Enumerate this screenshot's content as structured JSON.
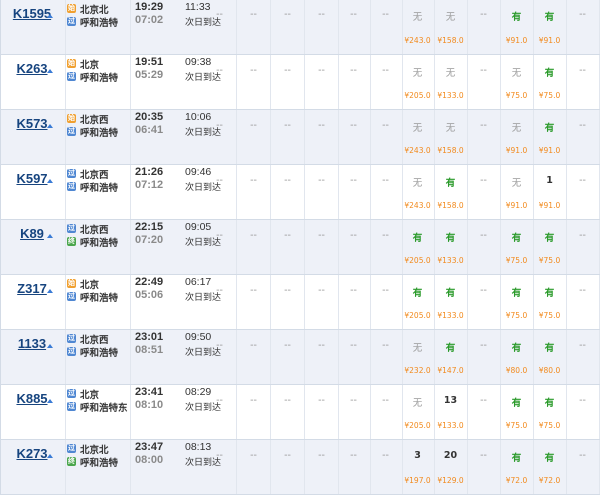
{
  "trains": [
    {
      "no": "K1595",
      "from_icon": "始",
      "to_icon": "过",
      "from": "北京北",
      "to": "呼和浩特",
      "dep": "19:29",
      "duration": "07:02",
      "arr": "11:33",
      "arr_day": "次日到达",
      "seats": {
        "c1": "--",
        "c2": "--",
        "c3": "--",
        "c4": "--",
        "c5": "--",
        "c6": "--",
        "c7": "无",
        "c8": "无",
        "c9": "--",
        "c10": "有",
        "c11": "有",
        "c12": "--"
      },
      "prices": {
        "c7": "¥243.0",
        "c8": "¥158.0",
        "c10": "¥91.0",
        "c11": "¥91.0"
      }
    },
    {
      "no": "K263",
      "from_icon": "始",
      "to_icon": "过",
      "from": "北京",
      "to": "呼和浩特",
      "dep": "19:51",
      "duration": "05:29",
      "arr": "09:38",
      "arr_day": "次日到达",
      "seats": {
        "c1": "--",
        "c2": "--",
        "c3": "--",
        "c4": "--",
        "c5": "--",
        "c6": "--",
        "c7": "无",
        "c8": "无",
        "c9": "--",
        "c10": "无",
        "c11": "有",
        "c12": "--"
      },
      "prices": {
        "c7": "¥205.0",
        "c8": "¥133.0",
        "c10": "¥75.0",
        "c11": "¥75.0"
      }
    },
    {
      "no": "K573",
      "from_icon": "始",
      "to_icon": "过",
      "from": "北京西",
      "to": "呼和浩特",
      "dep": "20:35",
      "duration": "06:41",
      "arr": "10:06",
      "arr_day": "次日到达",
      "seats": {
        "c1": "--",
        "c2": "--",
        "c3": "--",
        "c4": "--",
        "c5": "--",
        "c6": "--",
        "c7": "无",
        "c8": "无",
        "c9": "--",
        "c10": "无",
        "c11": "有",
        "c12": "--"
      },
      "prices": {
        "c7": "¥243.0",
        "c8": "¥158.0",
        "c10": "¥91.0",
        "c11": "¥91.0"
      }
    },
    {
      "no": "K597",
      "from_icon": "过",
      "to_icon": "过",
      "from": "北京西",
      "to": "呼和浩特",
      "dep": "21:26",
      "duration": "07:12",
      "arr": "09:46",
      "arr_day": "次日到达",
      "seats": {
        "c1": "--",
        "c2": "--",
        "c3": "--",
        "c4": "--",
        "c5": "--",
        "c6": "--",
        "c7": "无",
        "c8": "有",
        "c9": "--",
        "c10": "无",
        "c11": "1",
        "c12": "--"
      },
      "prices": {
        "c7": "¥243.0",
        "c8": "¥158.0",
        "c10": "¥91.0",
        "c11": "¥91.0"
      }
    },
    {
      "no": "K89",
      "from_icon": "过",
      "to_icon": "终",
      "from": "北京西",
      "to": "呼和浩特",
      "dep": "22:15",
      "duration": "07:20",
      "arr": "09:05",
      "arr_day": "次日到达",
      "seats": {
        "c1": "--",
        "c2": "--",
        "c3": "--",
        "c4": "--",
        "c5": "--",
        "c6": "--",
        "c7": "有",
        "c8": "有",
        "c9": "--",
        "c10": "有",
        "c11": "有",
        "c12": "--"
      },
      "prices": {
        "c7": "¥205.0",
        "c8": "¥133.0",
        "c10": "¥75.0",
        "c11": "¥75.0"
      }
    },
    {
      "no": "Z317",
      "from_icon": "始",
      "to_icon": "过",
      "from": "北京",
      "to": "呼和浩特",
      "dep": "22:49",
      "duration": "05:06",
      "arr": "06:17",
      "arr_day": "次日到达",
      "seats": {
        "c1": "--",
        "c2": "--",
        "c3": "--",
        "c4": "--",
        "c5": "--",
        "c6": "--",
        "c7": "有",
        "c8": "有",
        "c9": "--",
        "c10": "有",
        "c11": "有",
        "c12": "--"
      },
      "prices": {
        "c7": "¥205.0",
        "c8": "¥133.0",
        "c10": "¥75.0",
        "c11": "¥75.0"
      }
    },
    {
      "no": "1133",
      "from_icon": "过",
      "to_icon": "过",
      "from": "北京西",
      "to": "呼和浩特",
      "dep": "23:01",
      "duration": "08:51",
      "arr": "09:50",
      "arr_day": "次日到达",
      "seats": {
        "c1": "--",
        "c2": "--",
        "c3": "--",
        "c4": "--",
        "c5": "--",
        "c6": "--",
        "c7": "无",
        "c8": "有",
        "c9": "--",
        "c10": "有",
        "c11": "有",
        "c12": "--"
      },
      "prices": {
        "c7": "¥232.0",
        "c8": "¥147.0",
        "c10": "¥80.0",
        "c11": "¥80.0"
      }
    },
    {
      "no": "K885",
      "from_icon": "过",
      "to_icon": "过",
      "from": "北京",
      "to": "呼和浩特东",
      "dep": "23:41",
      "duration": "08:10",
      "arr": "08:29",
      "arr_day": "次日到达",
      "seats": {
        "c1": "--",
        "c2": "--",
        "c3": "--",
        "c4": "--",
        "c5": "--",
        "c6": "--",
        "c7": "无",
        "c8": "13",
        "c9": "--",
        "c10": "有",
        "c11": "有",
        "c12": "--"
      },
      "prices": {
        "c7": "¥205.0",
        "c8": "¥133.0",
        "c10": "¥75.0",
        "c11": "¥75.0"
      }
    },
    {
      "no": "K273",
      "from_icon": "过",
      "to_icon": "终",
      "from": "北京北",
      "to": "呼和浩特",
      "dep": "23:47",
      "duration": "08:00",
      "arr": "08:13",
      "arr_day": "次日到达",
      "seats": {
        "c1": "--",
        "c2": "--",
        "c3": "--",
        "c4": "--",
        "c5": "--",
        "c6": "--",
        "c7": "3",
        "c8": "20",
        "c9": "--",
        "c10": "有",
        "c11": "有",
        "c12": "--"
      },
      "prices": {
        "c7": "¥197.0",
        "c8": "¥129.0",
        "c10": "¥72.0",
        "c11": "¥72.0"
      }
    }
  ],
  "colors": {
    "available": "#2a9a2a",
    "none": "#999999",
    "price": "#f28a1d",
    "train_link": "#16447f",
    "highlight_row": "#eef1f8"
  }
}
